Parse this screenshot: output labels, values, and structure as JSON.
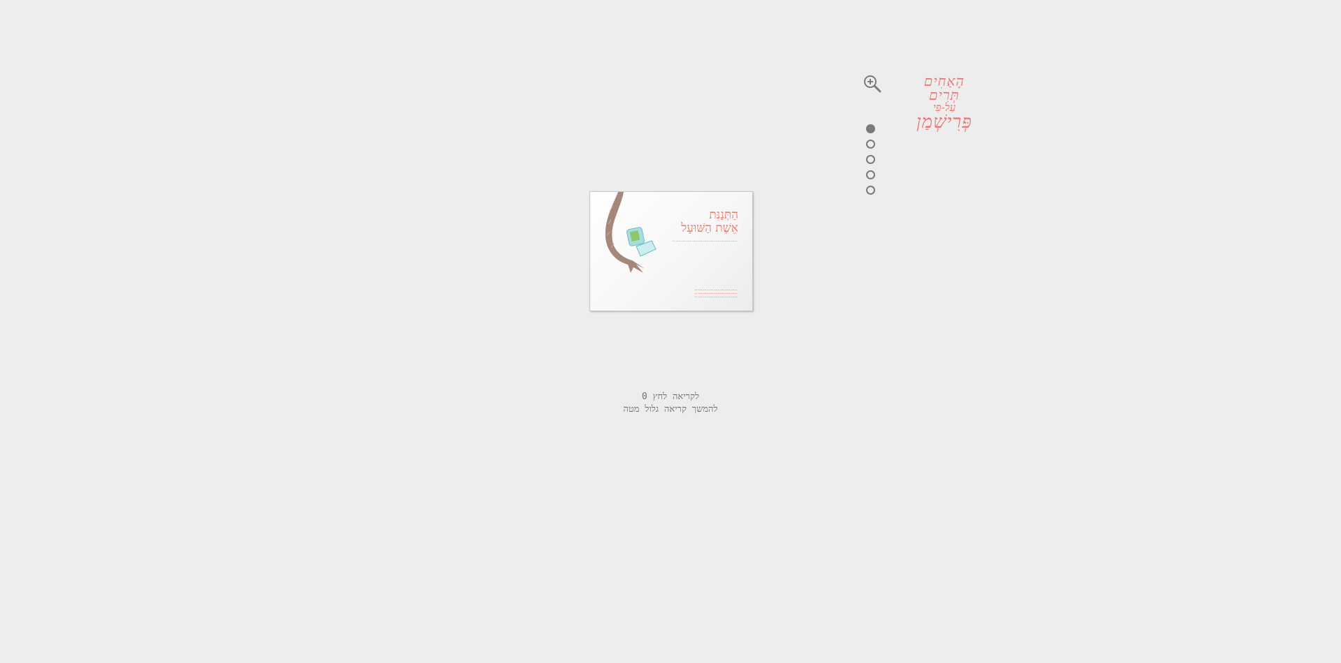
{
  "logo": {
    "line1": "הָאַחִים תְּרִים",
    "line2": "עַל-פִּי",
    "line3": "פְּרִישְׁמַן"
  },
  "zoom": {
    "icon": "zoom-in-icon"
  },
  "pagination": {
    "total": 5,
    "active_index": 0
  },
  "book": {
    "title_line1": "הַתְּנַנִּת",
    "title_line2": "אֵשֶׁת הַשּׁוּעָל"
  },
  "instructions": {
    "line1": "לקריאה לחץ 0",
    "line2": "להמשך קריאה גלול מטה"
  },
  "colors": {
    "background": "#ededed",
    "accent": "#e97575",
    "dots": "#7a7a7a",
    "text": "#6e6e6e"
  }
}
